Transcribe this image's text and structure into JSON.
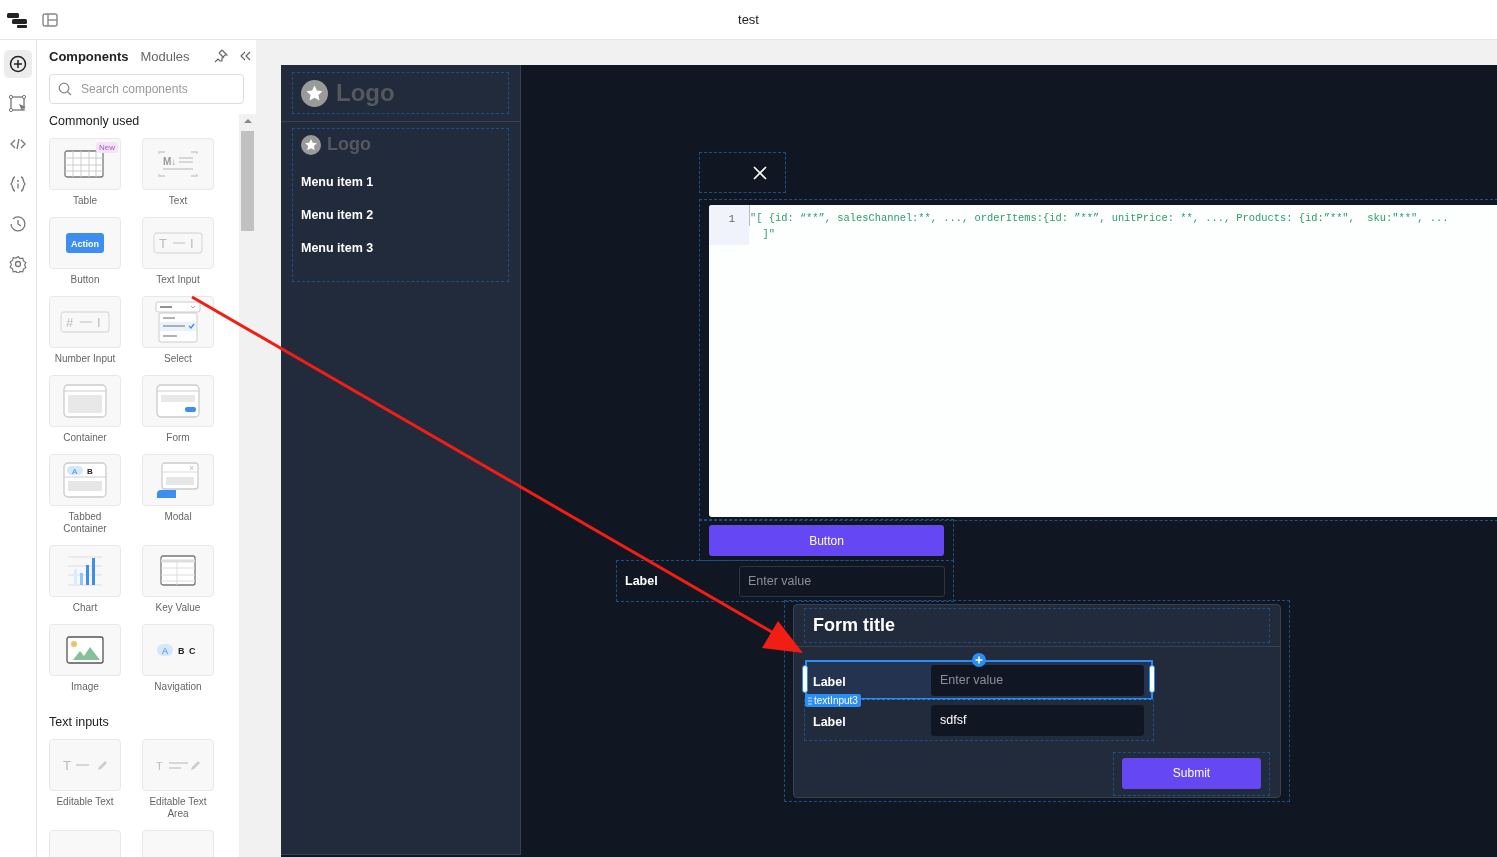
{
  "top_bar": {
    "title": "test"
  },
  "rail": [
    {
      "kind": "add",
      "selected": true
    },
    {
      "kind": "select",
      "selected": false
    },
    {
      "kind": "code",
      "selected": false
    },
    {
      "kind": "variables",
      "selected": false
    },
    {
      "kind": "history",
      "selected": false
    },
    {
      "kind": "settings",
      "selected": false
    }
  ],
  "panel": {
    "tabs": [
      {
        "label": "Components",
        "selected": true
      },
      {
        "label": "Modules",
        "selected": false
      }
    ],
    "search": {
      "placeholder": "Search components"
    },
    "sections": [
      {
        "title": "Commonly used",
        "items": [
          {
            "label": "Table",
            "kind": "table",
            "badge": "New"
          },
          {
            "label": "Text",
            "kind": "text",
            "icon_text": [
              "M↓"
            ]
          },
          {
            "label": "Button",
            "kind": "button",
            "icon_text": [
              "Action"
            ]
          },
          {
            "label": "Text Input",
            "kind": "text-input",
            "icon_text": [
              "T",
              "I"
            ]
          },
          {
            "label": "Number Input",
            "kind": "number-input",
            "icon_text": [
              "#",
              "I"
            ]
          },
          {
            "label": "Select",
            "kind": "select"
          },
          {
            "label": "Container",
            "kind": "container"
          },
          {
            "label": "Form",
            "kind": "form"
          },
          {
            "label": "Tabbed Container",
            "kind": "tabbed",
            "icon_text": [
              "A",
              "B"
            ]
          },
          {
            "label": "Modal",
            "kind": "modal",
            "icon_text": [
              "×"
            ]
          },
          {
            "label": "Chart",
            "kind": "chart"
          },
          {
            "label": "Key Value",
            "kind": "key-value"
          },
          {
            "label": "Image",
            "kind": "image"
          },
          {
            "label": "Navigation",
            "kind": "navigation",
            "icon_text": [
              "A",
              "B",
              "C"
            ]
          }
        ]
      },
      {
        "title": "Text inputs",
        "items": [
          {
            "label": "Editable Text",
            "kind": "editable-text",
            "icon_text": [
              "T"
            ]
          },
          {
            "label": "Editable Text Area",
            "kind": "editable-textarea",
            "icon_text": [
              "T"
            ]
          },
          {
            "kind": "blank"
          },
          {
            "kind": "blank"
          }
        ]
      }
    ]
  },
  "app": {
    "sidebar": {
      "header_logo": {
        "text": "Logo"
      },
      "nav_logo": {
        "text": "Logo"
      },
      "menu_items": [
        "Menu item 1",
        "Menu item 2",
        "Menu item 3"
      ]
    },
    "code_editor": {
      "line_number": "1",
      "lines": [
        "\"[ {id: “**”, salesChannel:**, ..., orderItems:{id: ”**”, unitPrice: **, ..., Products: {id:”**\",  sku:\"**\", ...",
        "  ]\""
      ]
    },
    "button": {
      "label": "Button"
    },
    "text_input": {
      "label": "Label",
      "placeholder": "Enter value"
    },
    "form": {
      "title": "Form title",
      "fields": [
        {
          "label": "Label",
          "placeholder": "Enter value",
          "selected": true
        },
        {
          "label": "Label",
          "value": "sdfsf",
          "selected": false
        }
      ],
      "selection_tag": "textInput3",
      "submit": "Submit"
    }
  },
  "annotation": {
    "kind": "arrow"
  }
}
